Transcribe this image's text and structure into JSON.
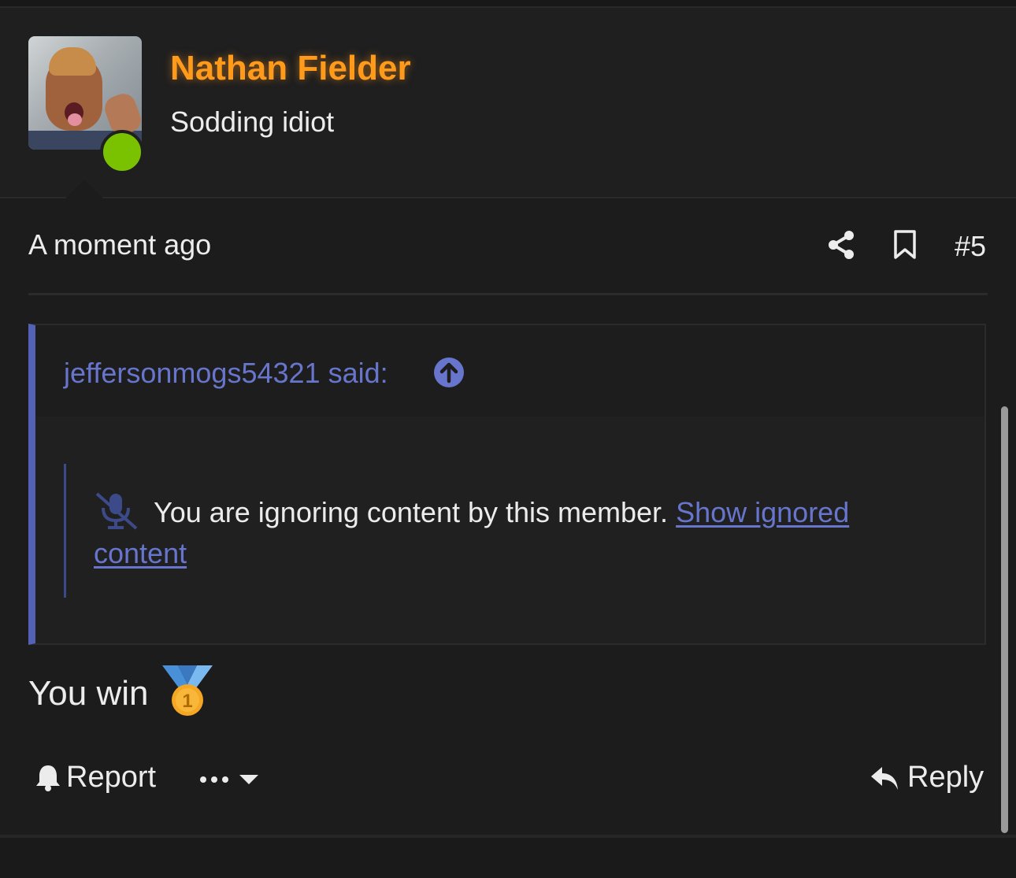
{
  "post": {
    "author": {
      "name": "Nathan Fielder",
      "title": "Sodding idiot",
      "online": true,
      "name_color": "#ff9a1a",
      "online_color": "#7ac200"
    },
    "timestamp": "A moment ago",
    "number": "#5",
    "quote": {
      "author_label": "jeffersonmogs54321 said:",
      "ignored_message": "You are ignoring content by this member.",
      "show_link": "Show ignored content",
      "accent_color": "#5362b4"
    },
    "body_text": "You win",
    "body_emoji": "first-place-medal-icon"
  },
  "actions": {
    "report_label": "Report",
    "reply_label": "Reply"
  },
  "icons": {
    "share": "share-icon",
    "bookmark": "bookmark-icon",
    "quote_jump": "arrow-up-circle-icon",
    "mute": "mute-icon",
    "bell": "bell-icon",
    "more": "more-dots-icon",
    "caret": "chevron-down-icon",
    "reply": "reply-icon"
  }
}
